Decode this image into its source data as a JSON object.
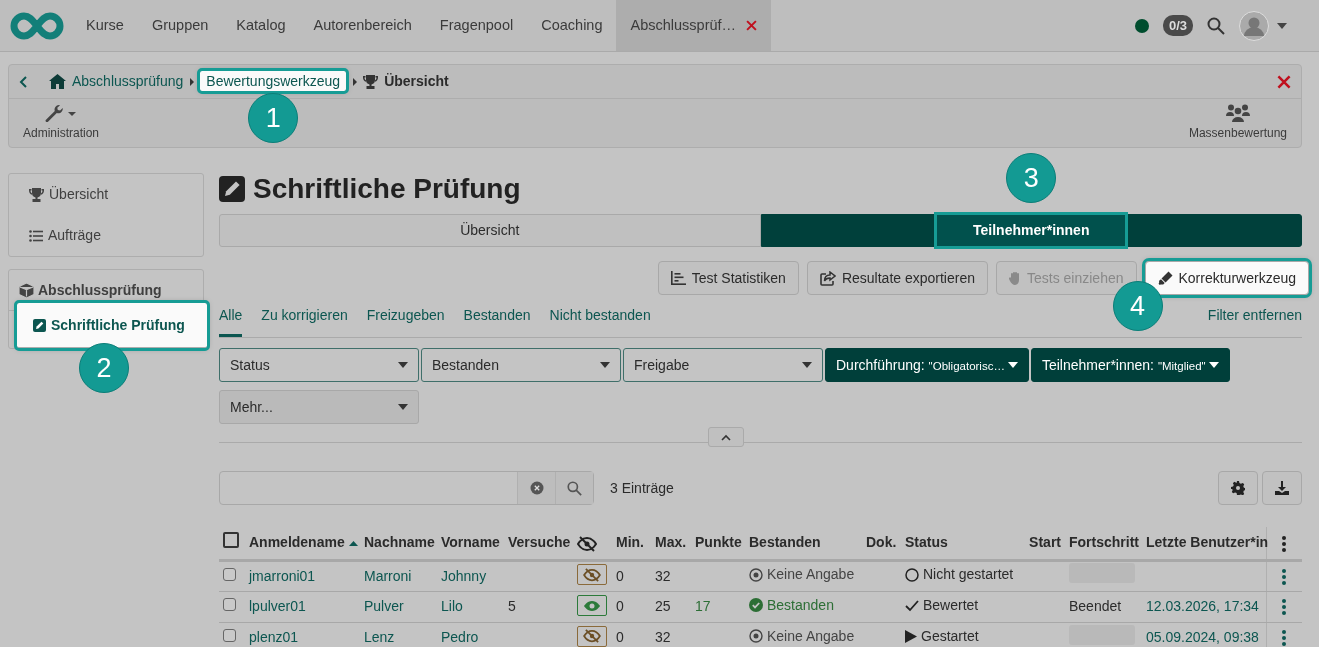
{
  "nav": {
    "items": [
      {
        "label": "Kurse",
        "selected": false,
        "closable": false
      },
      {
        "label": "Gruppen",
        "selected": false,
        "closable": false
      },
      {
        "label": "Katalog",
        "selected": false,
        "closable": false
      },
      {
        "label": "Autorenbereich",
        "selected": false,
        "closable": false
      },
      {
        "label": "Fragenpool",
        "selected": false,
        "closable": false
      },
      {
        "label": "Coaching",
        "selected": false,
        "closable": false
      },
      {
        "label": "Abschlussprüf…",
        "selected": true,
        "closable": true
      }
    ],
    "badge": "0/3"
  },
  "breadcrumb": [
    {
      "label": "Abschlussprüfung",
      "kind": "home",
      "highlighted": false
    },
    {
      "label": "Bewertungswerkzeug",
      "kind": "link",
      "highlighted": true,
      "callout": "1"
    },
    {
      "label": "Übersicht",
      "kind": "current",
      "highlighted": false
    }
  ],
  "toolbar": [
    {
      "label": "Administration",
      "kind": "admin"
    },
    {
      "label": "Massenbewertung",
      "kind": "bulk"
    }
  ],
  "sidebar": [
    {
      "items": [
        {
          "label": "Übersicht",
          "kind": "trophy",
          "selected": false,
          "highlighted": false
        },
        {
          "label": "Aufträge",
          "kind": "list",
          "selected": false,
          "highlighted": false
        }
      ]
    },
    {
      "title": "Abschlussprüfung",
      "items": [
        {
          "label": "Schriftliche Prüfung",
          "kind": "test",
          "selected": true,
          "highlighted": true,
          "callout": "2"
        }
      ]
    }
  ],
  "title": "Schriftliche Prüfung",
  "segments": [
    {
      "label": "Übersicht",
      "selected": false,
      "highlighted": false
    },
    {
      "label": "Teilnehmer*innen",
      "selected": true,
      "highlighted": true,
      "callout": "3"
    }
  ],
  "actions": [
    {
      "label": "Test Statistiken",
      "kind": "stats",
      "disabled": false,
      "highlighted": false
    },
    {
      "label": "Resultate exportieren",
      "kind": "export",
      "disabled": false,
      "highlighted": false
    },
    {
      "label": "Tests einziehen",
      "kind": "collect",
      "disabled": true,
      "highlighted": false
    },
    {
      "label": "Korrekturwerkzeug",
      "kind": "correct",
      "disabled": false,
      "highlighted": true,
      "callout": "4"
    }
  ],
  "filter_tabs": [
    {
      "label": "Alle",
      "selected": true
    },
    {
      "label": "Zu korrigieren",
      "selected": false
    },
    {
      "label": "Freizugeben",
      "selected": false
    },
    {
      "label": "Bestanden",
      "selected": false
    },
    {
      "label": "Nicht bestanden",
      "selected": false
    }
  ],
  "filter_reset": "Filter entfernen",
  "filters": [
    {
      "label": "Status",
      "kind": "filter",
      "active": false
    },
    {
      "label": "Bestanden",
      "kind": "filter",
      "active": false
    },
    {
      "label": "Freigabe",
      "kind": "filter",
      "active": false
    },
    {
      "label": "Durchführung:",
      "value": "\"Obligatorisc…",
      "kind": "filter",
      "active": true
    },
    {
      "label": "Teilnehmer*innen:",
      "value": "\"Mitglied\"",
      "kind": "filter",
      "active": true
    },
    {
      "label": "Mehr...",
      "kind": "more",
      "active": false
    }
  ],
  "search": {
    "count": "3 Einträge"
  },
  "table": {
    "select_all": {
      "checked": false
    },
    "columns": [
      {
        "label": "Anmeldename",
        "sorted": true
      },
      {
        "label": "Nachname",
        "sorted": false
      },
      {
        "label": "Vorname",
        "sorted": false
      },
      {
        "label": "Versuche",
        "sorted": false
      },
      {
        "kind": "visibility",
        "sorted": false
      },
      {
        "label": "Min.",
        "sorted": false
      },
      {
        "label": "Max.",
        "sorted": false
      },
      {
        "label": "Punkte",
        "sorted": false
      },
      {
        "label": "Bestanden",
        "sorted": false
      },
      {
        "label": "Dok.",
        "sorted": false
      },
      {
        "label": "Status",
        "sorted": false
      },
      {
        "label": "Start",
        "sorted": false
      },
      {
        "label": "Fortschritt",
        "sorted": false
      },
      {
        "label": "Letzte Benutzer*in",
        "sorted": false
      }
    ],
    "rows": [
      {
        "checked": false,
        "login": "jmarroni01",
        "last": "Marroni",
        "first": "Johnny",
        "visible": false,
        "min": "0",
        "max": "32",
        "passed": {
          "kind": "none",
          "label": "Keine Angabe"
        },
        "status": {
          "kind": "not_started",
          "label": "Nicht gestartet"
        },
        "progress": {
          "kind": "bar",
          "level": 0
        }
      },
      {
        "checked": false,
        "login": "lpulver01",
        "last": "Pulver",
        "first": "Lilo",
        "attempts": "5",
        "visible": true,
        "min": "0",
        "max": "25",
        "points": "17",
        "passed": {
          "kind": "passed",
          "label": "Bestanden"
        },
        "status": {
          "kind": "graded",
          "label": "Bewertet"
        },
        "progress": {
          "kind": "text",
          "label": "Beendet"
        },
        "last_user": "12.03.2026, 17:34"
      },
      {
        "checked": false,
        "login": "plenz01",
        "last": "Lenz",
        "first": "Pedro",
        "visible": false,
        "min": "0",
        "max": "32",
        "passed": {
          "kind": "none",
          "label": "Keine Angabe"
        },
        "status": {
          "kind": "started",
          "label": "Gestartet"
        },
        "progress": {
          "kind": "bar",
          "level": 0
        },
        "last_user": "05.09.2024, 09:38"
      }
    ]
  }
}
